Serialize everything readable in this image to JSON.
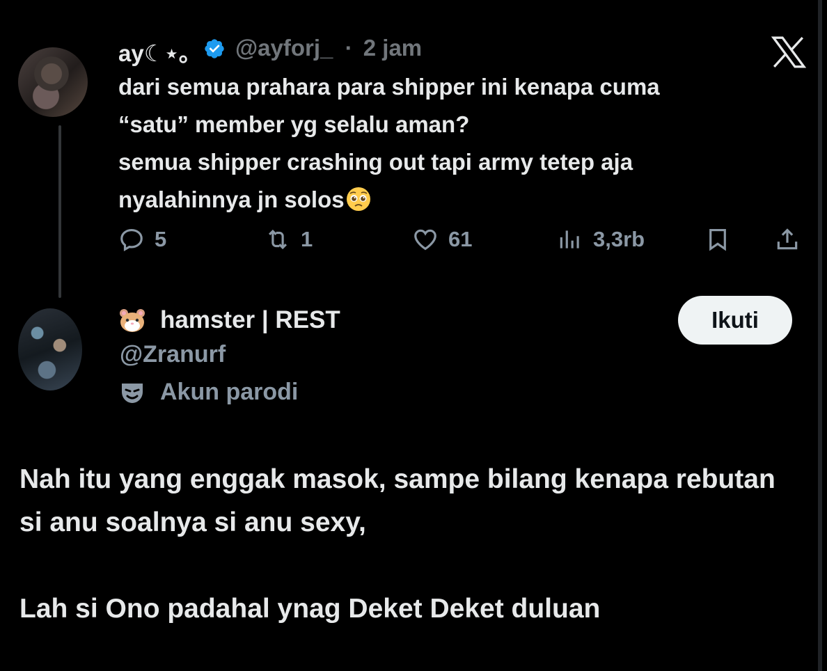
{
  "original_tweet": {
    "author_name": "ay☾⋆｡",
    "verified": true,
    "handle": "@ayforj_",
    "separator": "·",
    "time": "2 jam",
    "text_lines": [
      "dari semua prahara para shipper ini kenapa cuma",
      "“satu” member yg selalu aman?",
      "semua shipper crashing out tapi army tetep aja",
      "nyalahinnya jn solos"
    ],
    "trailing_emoji": "pleading-face",
    "actions": {
      "replies": "5",
      "reposts": "1",
      "likes": "61",
      "views": "3,3rb"
    }
  },
  "reply_tweet": {
    "author_name": "hamster | REST",
    "name_emoji": "hamster-face",
    "handle": "@Zranurf",
    "label": "Akun parodi",
    "follow_label": "Ikuti",
    "text_paragraphs": [
      "Nah itu yang enggak masok, sampe bilang kenapa rebutan si anu soalnya si anu sexy,",
      "Lah si Ono padahal ynag Deket Deket duluan"
    ]
  },
  "colors": {
    "background": "#000000",
    "text_primary": "#e7e9ea",
    "text_secondary": "#71767b",
    "verified_blue": "#1d9bf0",
    "follow_button_bg": "#eff3f4"
  }
}
